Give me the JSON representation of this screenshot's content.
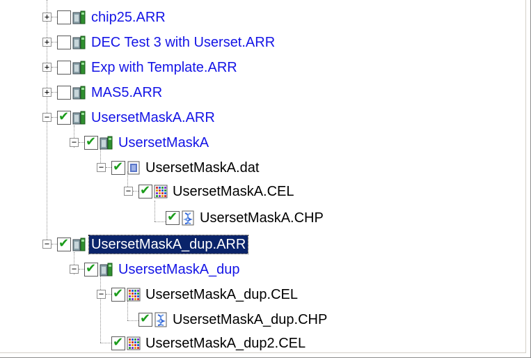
{
  "tree": {
    "items": [
      {
        "label": "chip25.ARR",
        "expander": "+",
        "checked": false,
        "icon": "chip-icon",
        "color": "#1414e6"
      },
      {
        "label": "DEC Test 3 with Userset.ARR",
        "expander": "+",
        "checked": false,
        "icon": "chip-icon",
        "color": "#1414e6"
      },
      {
        "label": "Exp with Template.ARR",
        "expander": "+",
        "checked": false,
        "icon": "chip-icon",
        "color": "#1414e6"
      },
      {
        "label": "MAS5.ARR",
        "expander": "+",
        "checked": false,
        "icon": "chip-icon",
        "color": "#1414e6"
      },
      {
        "label": "UsersetMaskA.ARR",
        "expander": "−",
        "checked": true,
        "icon": "chip-icon",
        "color": "#1414e6"
      },
      {
        "label": "UsersetMaskA",
        "expander": "−",
        "checked": true,
        "icon": "chip-icon",
        "color": "#1414e6"
      },
      {
        "label": "UsersetMaskA.dat",
        "expander": "−",
        "checked": true,
        "icon": "dat-icon",
        "color": "#000000"
      },
      {
        "label": "UsersetMaskA.CEL",
        "expander": "−",
        "checked": true,
        "icon": "cel-icon",
        "color": "#000000"
      },
      {
        "label": "UsersetMaskA.CHP",
        "expander": "",
        "checked": true,
        "icon": "chp-icon",
        "color": "#000000"
      },
      {
        "label": "UsersetMaskA_dup.ARR",
        "expander": "−",
        "checked": true,
        "icon": "chip-icon",
        "color": "#1414e6",
        "selected": true
      },
      {
        "label": "UsersetMaskA_dup",
        "expander": "−",
        "checked": true,
        "icon": "chip-icon",
        "color": "#1414e6"
      },
      {
        "label": "UsersetMaskA_dup.CEL",
        "expander": "−",
        "checked": true,
        "icon": "cel-icon",
        "color": "#000000"
      },
      {
        "label": "UsersetMaskA_dup.CHP",
        "expander": "",
        "checked": true,
        "icon": "chp-icon",
        "color": "#000000"
      },
      {
        "label": "UsersetMaskA_dup2.CEL",
        "expander": "",
        "checked": true,
        "icon": "cel-icon",
        "color": "#000000"
      }
    ]
  },
  "colors": {
    "link_blue": "#1414e6",
    "selection": "#0a246a",
    "check_green": "#1c9c1c"
  }
}
